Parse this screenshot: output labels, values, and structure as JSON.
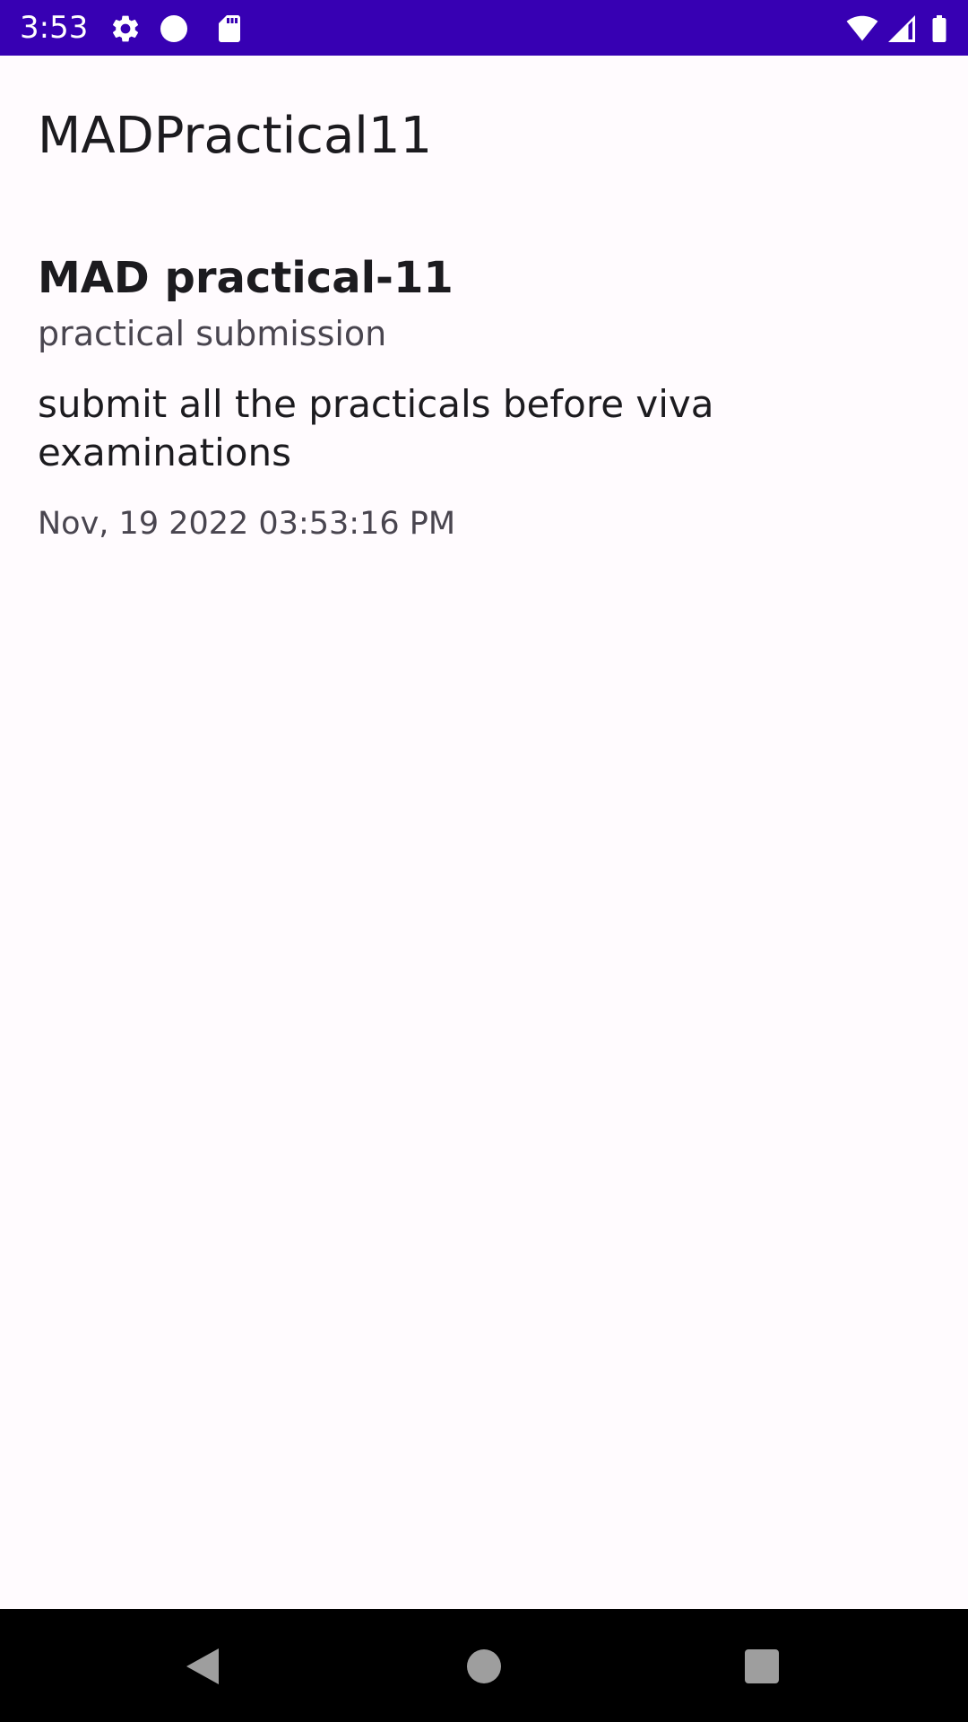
{
  "status_bar": {
    "time": "3:53",
    "background_color": "#3700b3",
    "left_icons": [
      "settings-gear-icon",
      "circle-icon",
      "sd-card-icon"
    ],
    "right_icons": [
      "wifi-icon",
      "signal-icon",
      "battery-icon"
    ]
  },
  "app_bar": {
    "title": "MADPractical11"
  },
  "note": {
    "title": "MAD practical-11",
    "subtitle": "practical submission",
    "body": "submit all the practicals before viva examinations",
    "date": "Nov, 19 2022 03:53:16 PM"
  },
  "nav_bar": {
    "buttons": [
      "back-icon",
      "home-icon",
      "recents-icon"
    ]
  }
}
